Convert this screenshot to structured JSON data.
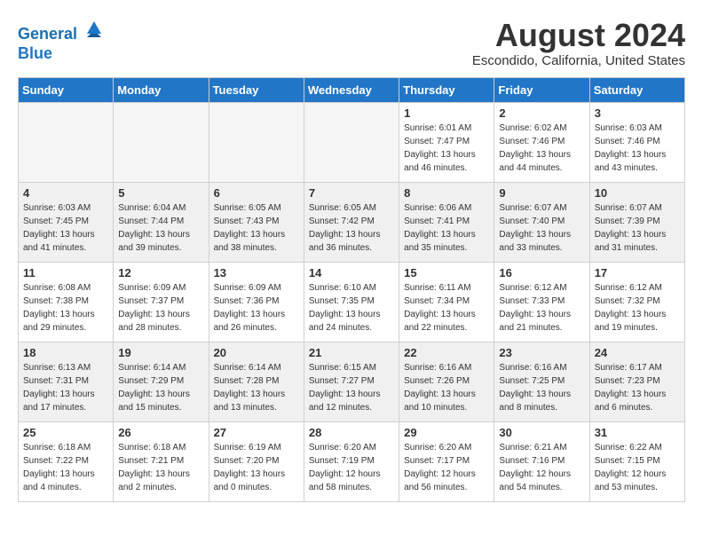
{
  "header": {
    "logo_line1": "General",
    "logo_line2": "Blue",
    "month_year": "August 2024",
    "location": "Escondido, California, United States"
  },
  "days_of_week": [
    "Sunday",
    "Monday",
    "Tuesday",
    "Wednesday",
    "Thursday",
    "Friday",
    "Saturday"
  ],
  "weeks": [
    [
      {
        "num": "",
        "info": ""
      },
      {
        "num": "",
        "info": ""
      },
      {
        "num": "",
        "info": ""
      },
      {
        "num": "",
        "info": ""
      },
      {
        "num": "1",
        "info": "Sunrise: 6:01 AM\nSunset: 7:47 PM\nDaylight: 13 hours\nand 46 minutes."
      },
      {
        "num": "2",
        "info": "Sunrise: 6:02 AM\nSunset: 7:46 PM\nDaylight: 13 hours\nand 44 minutes."
      },
      {
        "num": "3",
        "info": "Sunrise: 6:03 AM\nSunset: 7:46 PM\nDaylight: 13 hours\nand 43 minutes."
      }
    ],
    [
      {
        "num": "4",
        "info": "Sunrise: 6:03 AM\nSunset: 7:45 PM\nDaylight: 13 hours\nand 41 minutes."
      },
      {
        "num": "5",
        "info": "Sunrise: 6:04 AM\nSunset: 7:44 PM\nDaylight: 13 hours\nand 39 minutes."
      },
      {
        "num": "6",
        "info": "Sunrise: 6:05 AM\nSunset: 7:43 PM\nDaylight: 13 hours\nand 38 minutes."
      },
      {
        "num": "7",
        "info": "Sunrise: 6:05 AM\nSunset: 7:42 PM\nDaylight: 13 hours\nand 36 minutes."
      },
      {
        "num": "8",
        "info": "Sunrise: 6:06 AM\nSunset: 7:41 PM\nDaylight: 13 hours\nand 35 minutes."
      },
      {
        "num": "9",
        "info": "Sunrise: 6:07 AM\nSunset: 7:40 PM\nDaylight: 13 hours\nand 33 minutes."
      },
      {
        "num": "10",
        "info": "Sunrise: 6:07 AM\nSunset: 7:39 PM\nDaylight: 13 hours\nand 31 minutes."
      }
    ],
    [
      {
        "num": "11",
        "info": "Sunrise: 6:08 AM\nSunset: 7:38 PM\nDaylight: 13 hours\nand 29 minutes."
      },
      {
        "num": "12",
        "info": "Sunrise: 6:09 AM\nSunset: 7:37 PM\nDaylight: 13 hours\nand 28 minutes."
      },
      {
        "num": "13",
        "info": "Sunrise: 6:09 AM\nSunset: 7:36 PM\nDaylight: 13 hours\nand 26 minutes."
      },
      {
        "num": "14",
        "info": "Sunrise: 6:10 AM\nSunset: 7:35 PM\nDaylight: 13 hours\nand 24 minutes."
      },
      {
        "num": "15",
        "info": "Sunrise: 6:11 AM\nSunset: 7:34 PM\nDaylight: 13 hours\nand 22 minutes."
      },
      {
        "num": "16",
        "info": "Sunrise: 6:12 AM\nSunset: 7:33 PM\nDaylight: 13 hours\nand 21 minutes."
      },
      {
        "num": "17",
        "info": "Sunrise: 6:12 AM\nSunset: 7:32 PM\nDaylight: 13 hours\nand 19 minutes."
      }
    ],
    [
      {
        "num": "18",
        "info": "Sunrise: 6:13 AM\nSunset: 7:31 PM\nDaylight: 13 hours\nand 17 minutes."
      },
      {
        "num": "19",
        "info": "Sunrise: 6:14 AM\nSunset: 7:29 PM\nDaylight: 13 hours\nand 15 minutes."
      },
      {
        "num": "20",
        "info": "Sunrise: 6:14 AM\nSunset: 7:28 PM\nDaylight: 13 hours\nand 13 minutes."
      },
      {
        "num": "21",
        "info": "Sunrise: 6:15 AM\nSunset: 7:27 PM\nDaylight: 13 hours\nand 12 minutes."
      },
      {
        "num": "22",
        "info": "Sunrise: 6:16 AM\nSunset: 7:26 PM\nDaylight: 13 hours\nand 10 minutes."
      },
      {
        "num": "23",
        "info": "Sunrise: 6:16 AM\nSunset: 7:25 PM\nDaylight: 13 hours\nand 8 minutes."
      },
      {
        "num": "24",
        "info": "Sunrise: 6:17 AM\nSunset: 7:23 PM\nDaylight: 13 hours\nand 6 minutes."
      }
    ],
    [
      {
        "num": "25",
        "info": "Sunrise: 6:18 AM\nSunset: 7:22 PM\nDaylight: 13 hours\nand 4 minutes."
      },
      {
        "num": "26",
        "info": "Sunrise: 6:18 AM\nSunset: 7:21 PM\nDaylight: 13 hours\nand 2 minutes."
      },
      {
        "num": "27",
        "info": "Sunrise: 6:19 AM\nSunset: 7:20 PM\nDaylight: 13 hours\nand 0 minutes."
      },
      {
        "num": "28",
        "info": "Sunrise: 6:20 AM\nSunset: 7:19 PM\nDaylight: 12 hours\nand 58 minutes."
      },
      {
        "num": "29",
        "info": "Sunrise: 6:20 AM\nSunset: 7:17 PM\nDaylight: 12 hours\nand 56 minutes."
      },
      {
        "num": "30",
        "info": "Sunrise: 6:21 AM\nSunset: 7:16 PM\nDaylight: 12 hours\nand 54 minutes."
      },
      {
        "num": "31",
        "info": "Sunrise: 6:22 AM\nSunset: 7:15 PM\nDaylight: 12 hours\nand 53 minutes."
      }
    ]
  ]
}
